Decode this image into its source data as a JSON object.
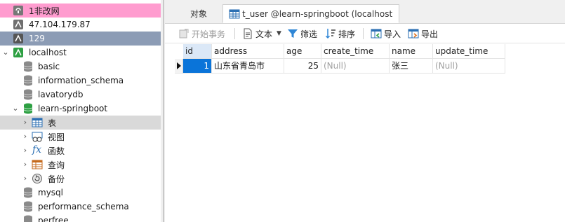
{
  "nav": {
    "connections": [
      {
        "label": "1非改网",
        "bg": "#ff9ccf"
      },
      {
        "label": "47.104.179.87",
        "bg": "#ffffff"
      },
      {
        "label": "129",
        "bg": "#8c9cb5"
      }
    ],
    "localhost": {
      "label": "localhost",
      "databases": [
        "basic",
        "information_schema",
        "lavatorydb"
      ],
      "open_db": {
        "label": "learn-springboot",
        "children": [
          {
            "label": "表",
            "icon": "table-icon"
          },
          {
            "label": "视图",
            "icon": "view-icon"
          },
          {
            "label": "函数",
            "icon": "function-icon"
          },
          {
            "label": "查询",
            "icon": "query-icon"
          },
          {
            "label": "备份",
            "icon": "backup-icon"
          }
        ]
      },
      "more_databases": [
        "mysql",
        "performance_schema",
        "perfree"
      ]
    }
  },
  "tabs": [
    {
      "label": "对象"
    },
    {
      "label": "t_user @learn-springboot (localhost)..."
    }
  ],
  "toolbar": {
    "begin_transaction": "开始事务",
    "text": "文本",
    "filter": "筛选",
    "sort": "排序",
    "import": "导入",
    "export": "导出"
  },
  "grid": {
    "columns": [
      "id",
      "address",
      "age",
      "create_time",
      "name",
      "update_time"
    ],
    "rows": [
      {
        "id": "1",
        "address": "山东省青岛市",
        "age": "25",
        "create_time": "(Null)",
        "name": "张三",
        "update_time": "(Null)"
      }
    ]
  },
  "colors": {
    "selected_cell": "#0a74d9",
    "nav_hover": "#d9d9d9",
    "db_green": "#2ea043"
  }
}
